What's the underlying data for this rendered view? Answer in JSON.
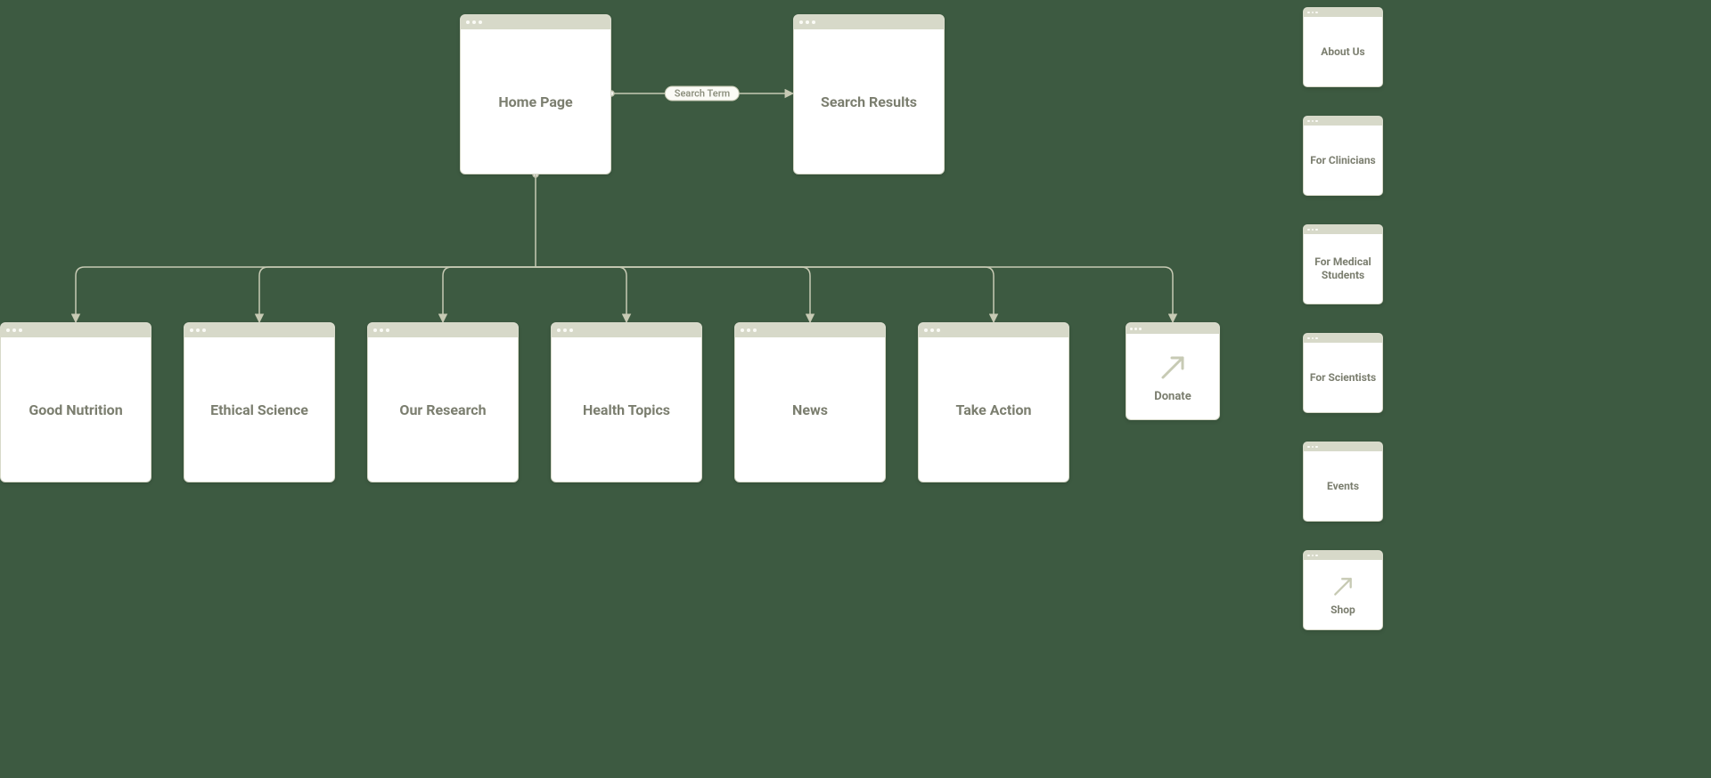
{
  "pages": {
    "home": {
      "label": "Home Page"
    },
    "search_results": {
      "label": "Search Results"
    },
    "good_nutrition": {
      "label": "Good Nutrition"
    },
    "ethical_science": {
      "label": "Ethical Science"
    },
    "our_research": {
      "label": "Our Research"
    },
    "health_topics": {
      "label": "Health Topics"
    },
    "news": {
      "label": "News"
    },
    "take_action": {
      "label": "Take Action"
    },
    "donate": {
      "label": "Donate"
    }
  },
  "edge": {
    "search_pill": "Search Term"
  },
  "sidebar": [
    {
      "label": "About Us",
      "external": false
    },
    {
      "label": "For Clinicians",
      "external": false
    },
    {
      "label": "For Medical Students",
      "external": false
    },
    {
      "label": "For Scientists",
      "external": false
    },
    {
      "label": "Events",
      "external": false
    },
    {
      "label": "Shop",
      "external": true
    }
  ],
  "icons": {
    "external_link": "external-link-arrow-icon"
  },
  "colors": {
    "background": "#3d5a41",
    "card_bg": "#ffffff",
    "chrome": "#d7d9c9",
    "text": "#7b7e6f",
    "connector": "#c7cab4"
  }
}
